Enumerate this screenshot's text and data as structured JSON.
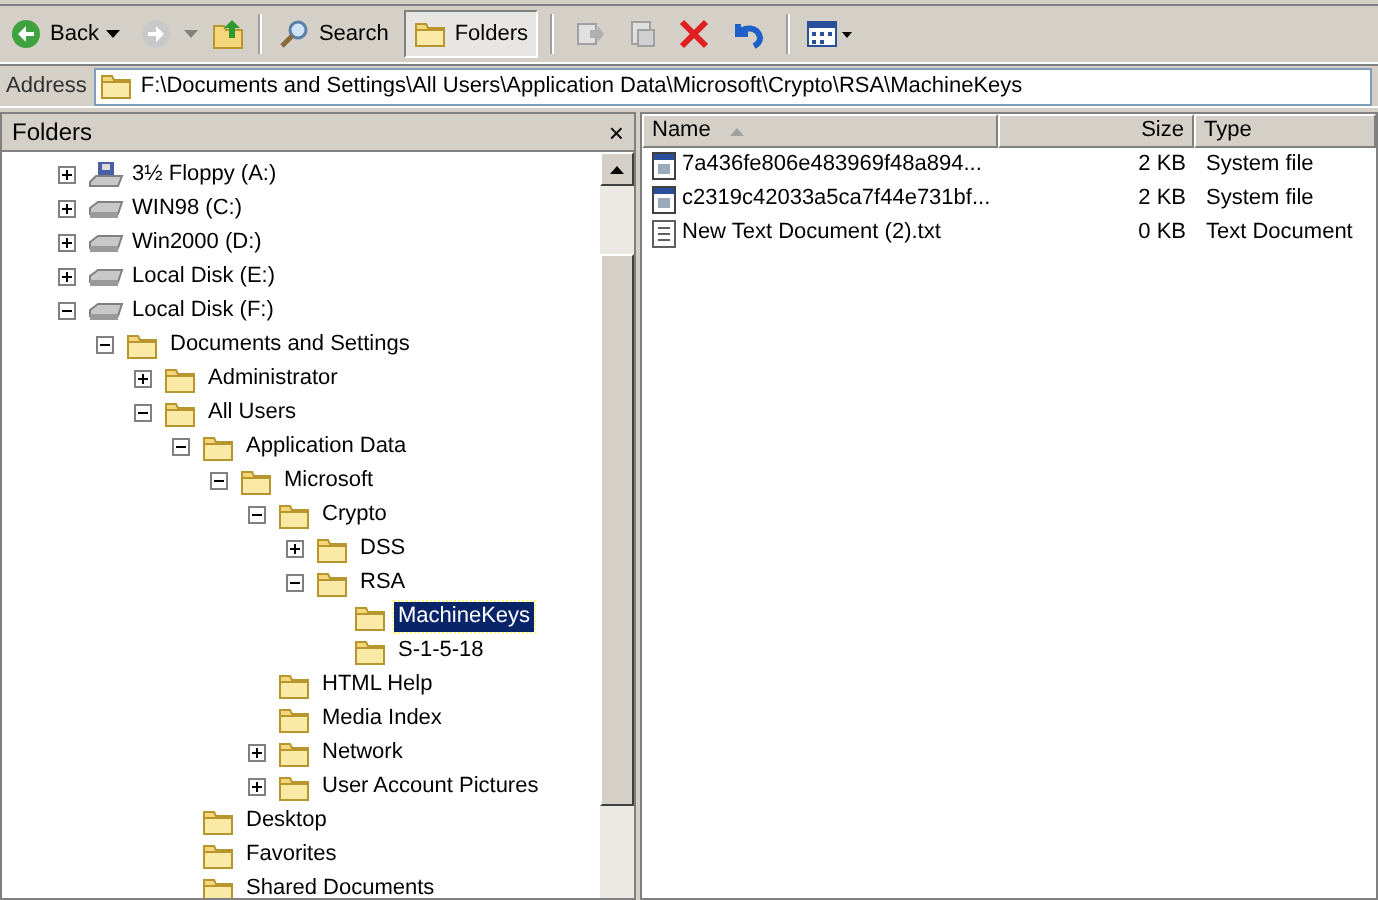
{
  "toolbar": {
    "back": "Back",
    "search": "Search",
    "folders": {
      "label": "Folders",
      "selected": true
    }
  },
  "address": {
    "label": "Address",
    "value": "F:\\Documents and Settings\\All Users\\Application Data\\Microsoft\\Crypto\\RSA\\MachineKeys"
  },
  "folders_pane": {
    "title": "Folders",
    "close": "×",
    "tree": [
      {
        "label": "3½ Floppy (A:)",
        "kind": "floppy",
        "expanded": false,
        "selected": false
      },
      {
        "label": "WIN98 (C:)",
        "kind": "drive",
        "expanded": false,
        "selected": false
      },
      {
        "label": "Win2000 (D:)",
        "kind": "drive",
        "expanded": false,
        "selected": false
      },
      {
        "label": "Local Disk (E:)",
        "kind": "drive",
        "expanded": false,
        "selected": false
      },
      {
        "label": "Local Disk (F:)",
        "kind": "drive",
        "expanded": true,
        "selected": false,
        "children": [
          {
            "label": "Documents and Settings",
            "kind": "folder",
            "expanded": true,
            "selected": false,
            "children": [
              {
                "label": "Administrator",
                "kind": "folder",
                "expanded": false,
                "selected": false
              },
              {
                "label": "All Users",
                "kind": "folder",
                "expanded": true,
                "selected": false,
                "children": [
                  {
                    "label": "Application Data",
                    "kind": "folder",
                    "expanded": true,
                    "selected": false,
                    "children": [
                      {
                        "label": "Microsoft",
                        "kind": "folder",
                        "expanded": true,
                        "selected": false,
                        "children": [
                          {
                            "label": "Crypto",
                            "kind": "folder",
                            "expanded": true,
                            "selected": false,
                            "children": [
                              {
                                "label": "DSS",
                                "kind": "folder",
                                "expanded": false,
                                "selected": false
                              },
                              {
                                "label": "RSA",
                                "kind": "folder",
                                "expanded": true,
                                "selected": false,
                                "children": [
                                  {
                                    "label": "MachineKeys",
                                    "kind": "folder",
                                    "selected": true
                                  },
                                  {
                                    "label": "S-1-5-18",
                                    "kind": "folder",
                                    "selected": false
                                  }
                                ]
                              }
                            ]
                          },
                          {
                            "label": "HTML Help",
                            "kind": "folder",
                            "selected": false
                          },
                          {
                            "label": "Media Index",
                            "kind": "folder",
                            "selected": false
                          },
                          {
                            "label": "Network",
                            "kind": "folder",
                            "expanded": false,
                            "selected": false
                          },
                          {
                            "label": "User Account Pictures",
                            "kind": "folder",
                            "expanded": false,
                            "selected": false
                          }
                        ]
                      }
                    ]
                  },
                  {
                    "label": "Desktop",
                    "kind": "folder",
                    "selected": false
                  },
                  {
                    "label": "Favorites",
                    "kind": "folder",
                    "selected": false
                  },
                  {
                    "label": "Shared Documents",
                    "kind": "folder",
                    "selected": false
                  }
                ]
              }
            ]
          }
        ]
      }
    ]
  },
  "file_list": {
    "columns": [
      "Name",
      "Size",
      "Type"
    ],
    "rows": [
      {
        "kind": "system",
        "name": "7a436fe806e483969f48a894...",
        "size": "2 KB",
        "type": "System file"
      },
      {
        "kind": "system",
        "name": "c2319c42033a5ca7f44e731bf...",
        "size": "2 KB",
        "type": "System file"
      },
      {
        "kind": "text",
        "name": "New Text Document (2).txt",
        "size": "0 KB",
        "type": "Text Document"
      }
    ]
  }
}
